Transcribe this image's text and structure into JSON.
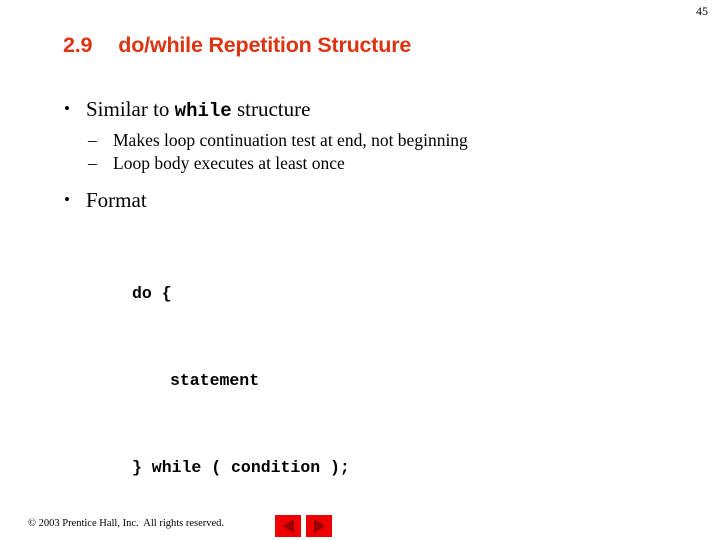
{
  "page": {
    "number": "45",
    "background_color": "#ffffff"
  },
  "title": {
    "section_number": "2.9",
    "text": "do/while Repetition Structure",
    "color": "#DD3311"
  },
  "content": {
    "bullets": [
      {
        "level": 1,
        "marker": "•",
        "parts": [
          {
            "text": "Similar to ",
            "style": "serif"
          },
          {
            "text": "while",
            "style": "mono-bold"
          },
          {
            "text": " structure",
            "style": "serif"
          }
        ]
      },
      {
        "level": 2,
        "marker": "–",
        "text": "Makes loop continuation test at end, not beginning"
      },
      {
        "level": 2,
        "marker": "–",
        "text": "Loop body executes at least once"
      },
      {
        "level": 1,
        "marker": "•",
        "parts": [
          {
            "text": "Format",
            "style": "serif"
          }
        ]
      }
    ],
    "code_block": {
      "lines": [
        {
          "text": "do {",
          "indent": 0
        },
        {
          "text": "statement",
          "indent": 1
        },
        {
          "text": "} while ( condition );",
          "indent": 0
        }
      ]
    }
  },
  "footer": {
    "copyright": "© 2003 Prentice Hall, Inc.  All rights reserved.",
    "nav": {
      "prev_label": "Previous slide",
      "next_label": "Next slide",
      "button_color": "#EE0000",
      "arrow_color": "#990000"
    }
  }
}
